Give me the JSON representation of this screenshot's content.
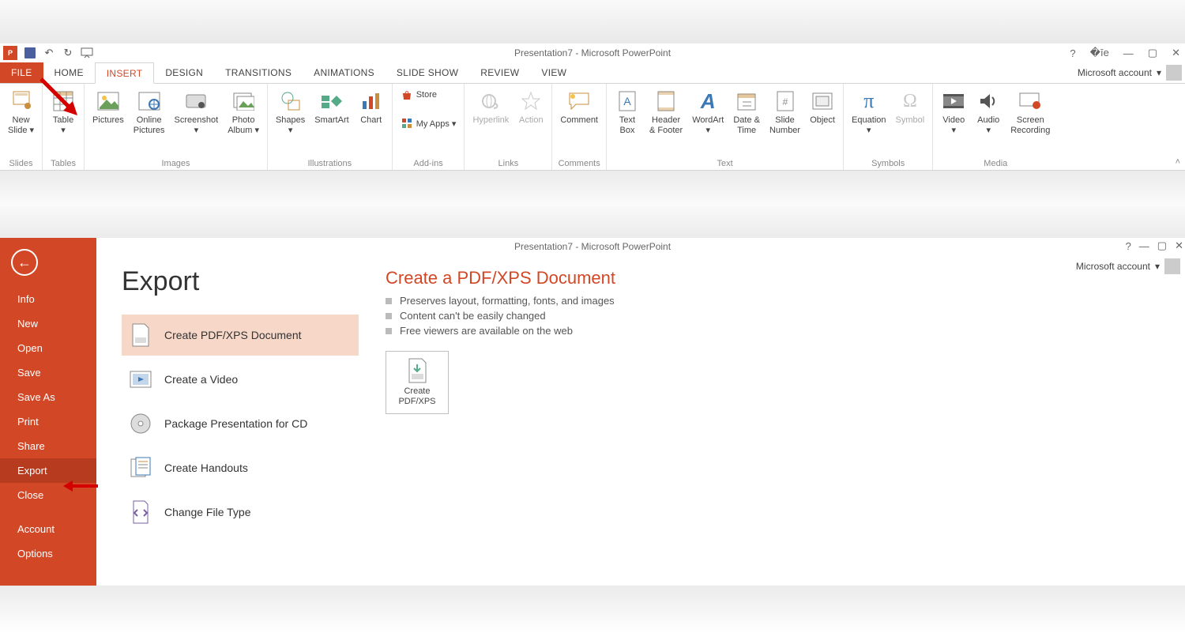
{
  "window_title": "Presentation7 - Microsoft PowerPoint",
  "account_label": "Microsoft account",
  "tabs": {
    "file": "FILE",
    "home": "HOME",
    "insert": "INSERT",
    "design": "DESIGN",
    "transitions": "TRANSITIONS",
    "animations": "ANIMATIONS",
    "slideshow": "SLIDE SHOW",
    "review": "REVIEW",
    "view": "VIEW"
  },
  "ribbon": {
    "slides": {
      "label": "Slides",
      "new_slide": "New\nSlide ▾"
    },
    "tables": {
      "label": "Tables",
      "table": "Table\n▾"
    },
    "images": {
      "label": "Images",
      "pictures": "Pictures",
      "online": "Online\nPictures",
      "screenshot": "Screenshot\n▾",
      "album": "Photo\nAlbum ▾"
    },
    "illustrations": {
      "label": "Illustrations",
      "shapes": "Shapes\n▾",
      "smartart": "SmartArt",
      "chart": "Chart"
    },
    "addins": {
      "label": "Add-ins",
      "store": "Store",
      "myapps": "My Apps ▾"
    },
    "links": {
      "label": "Links",
      "hyperlink": "Hyperlink",
      "action": "Action"
    },
    "comments": {
      "label": "Comments",
      "comment": "Comment"
    },
    "text": {
      "label": "Text",
      "textbox": "Text\nBox",
      "header": "Header\n& Footer",
      "wordart": "WordArt\n▾",
      "datetime": "Date &\nTime",
      "slidenum": "Slide\nNumber",
      "object": "Object"
    },
    "symbols": {
      "label": "Symbols",
      "equation": "Equation\n▾",
      "symbol": "Symbol"
    },
    "media": {
      "label": "Media",
      "video": "Video\n▾",
      "audio": "Audio\n▾",
      "screenrec": "Screen\nRecording"
    }
  },
  "backstage": {
    "nav": {
      "info": "Info",
      "new": "New",
      "open": "Open",
      "save": "Save",
      "saveas": "Save As",
      "print": "Print",
      "share": "Share",
      "export": "Export",
      "close": "Close",
      "account": "Account",
      "options": "Options"
    },
    "title": "Export",
    "options": {
      "pdf": "Create PDF/XPS Document",
      "video": "Create a Video",
      "cd": "Package Presentation for CD",
      "handouts": "Create Handouts",
      "filetype": "Change File Type"
    },
    "detail": {
      "heading": "Create a PDF/XPS Document",
      "b1": "Preserves layout, formatting, fonts, and images",
      "b2": "Content can't be easily changed",
      "b3": "Free viewers are available on the web",
      "button": "Create\nPDF/XPS"
    }
  }
}
